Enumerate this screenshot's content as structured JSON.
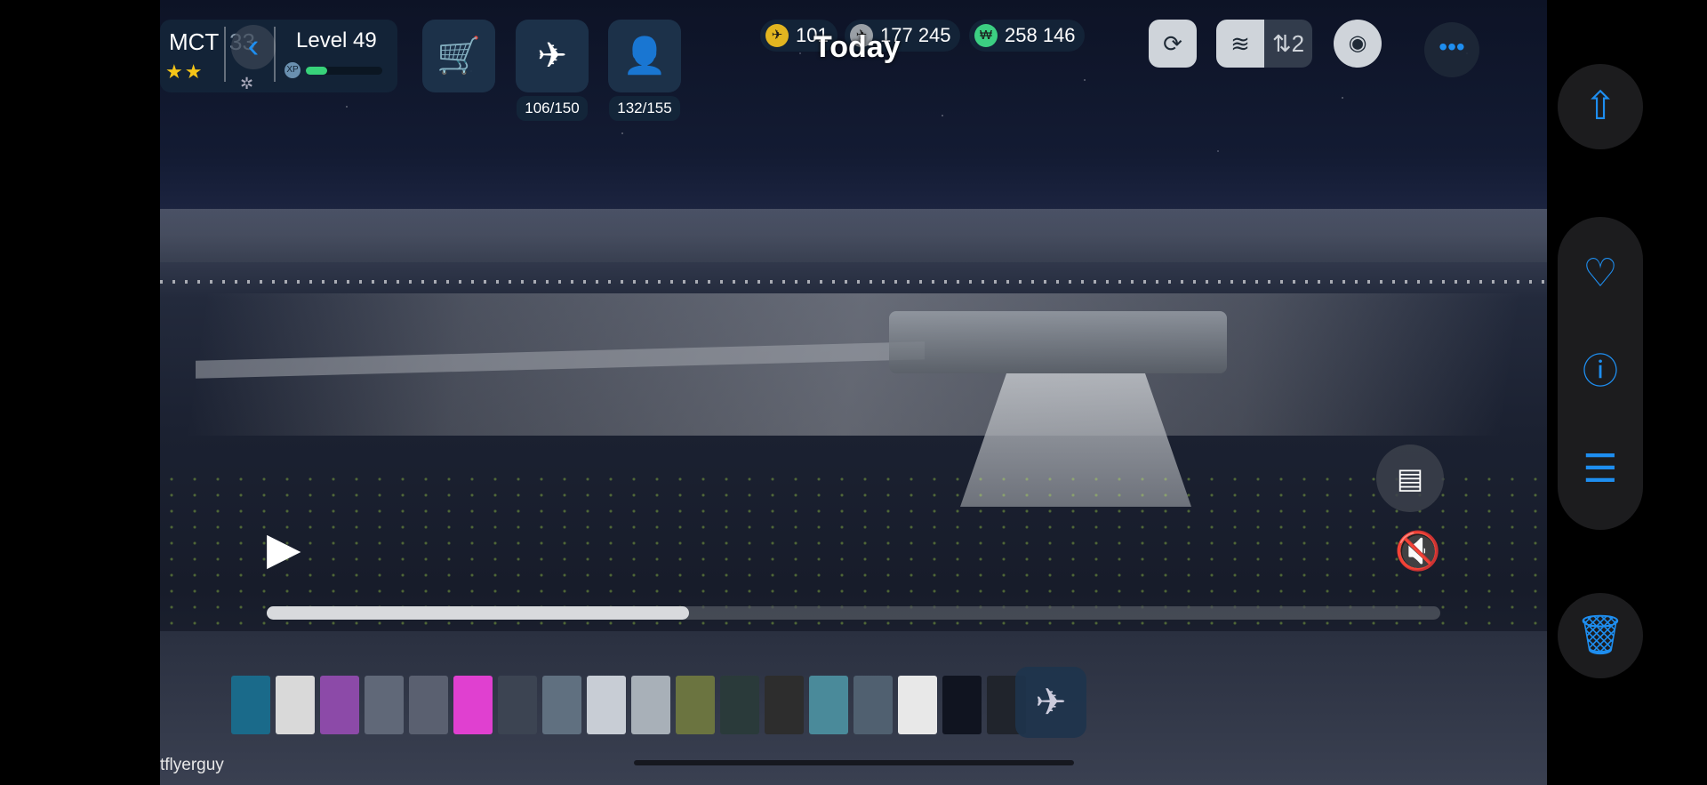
{
  "hud": {
    "airport_code": "MCT",
    "partial_number": "33",
    "stars": "★★",
    "level": "Level 49",
    "xp_progress": 0.28,
    "planes_count": "106/150",
    "staff_count": "132/155"
  },
  "currencies": [
    {
      "icon": "coin-icon",
      "value": "101",
      "color": "#e2b520"
    },
    {
      "icon": "passenger-coin-icon",
      "value": "177 245",
      "color": "#9aa0a6"
    },
    {
      "icon": "cash-icon",
      "value": "258 146",
      "color": "#3ccf82"
    }
  ],
  "date_label": "Today",
  "toolbar": {
    "refresh_label": "⟳",
    "layers_label": "≋",
    "traffic_label": "⇅2",
    "eye_label": "◉",
    "more_label": "•••"
  },
  "video": {
    "play_glyph": "▶",
    "mute_glyph": "🔇",
    "scan_glyph": "▤",
    "progress": 0.36
  },
  "filmstrip_colors": [
    "#1a6a8a",
    "#d9d9d9",
    "#8c4aa8",
    "#606878",
    "#5a6070",
    "#e040d0",
    "#3c4452",
    "#607080",
    "#c8cdd5",
    "#a8b0b8",
    "#6b7440",
    "#2a3a3a",
    "#2d2d2d",
    "#4a8a9a",
    "#506070",
    "#e8e8e8",
    "#101420",
    "#20242c"
  ],
  "username": "tflyerguy",
  "sidebar": {
    "share_glyph": "⇧",
    "favorite_glyph": "♡",
    "info_glyph": "ⓘ",
    "adjust_glyph": "☰",
    "delete_glyph": "🗑"
  }
}
